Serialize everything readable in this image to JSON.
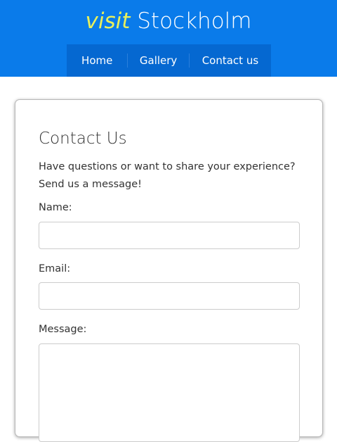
{
  "header": {
    "logo_accent": "visit",
    "logo_main": "Stockholm",
    "bg_color": "#0a7bea",
    "nav_bg_color": "#0568d1",
    "accent_color": "#e8f05c"
  },
  "nav": {
    "items": [
      {
        "label": "Home"
      },
      {
        "label": "Gallery"
      },
      {
        "label": "Contact us"
      }
    ]
  },
  "contact": {
    "title": "Contact Us",
    "description_line1": "Have questions or want to share your experience?",
    "description_line2": "Send us a message!",
    "fields": {
      "name_label": "Name:",
      "name_value": "",
      "email_label": "Email:",
      "email_value": "",
      "message_label": "Message:",
      "message_value": ""
    }
  }
}
